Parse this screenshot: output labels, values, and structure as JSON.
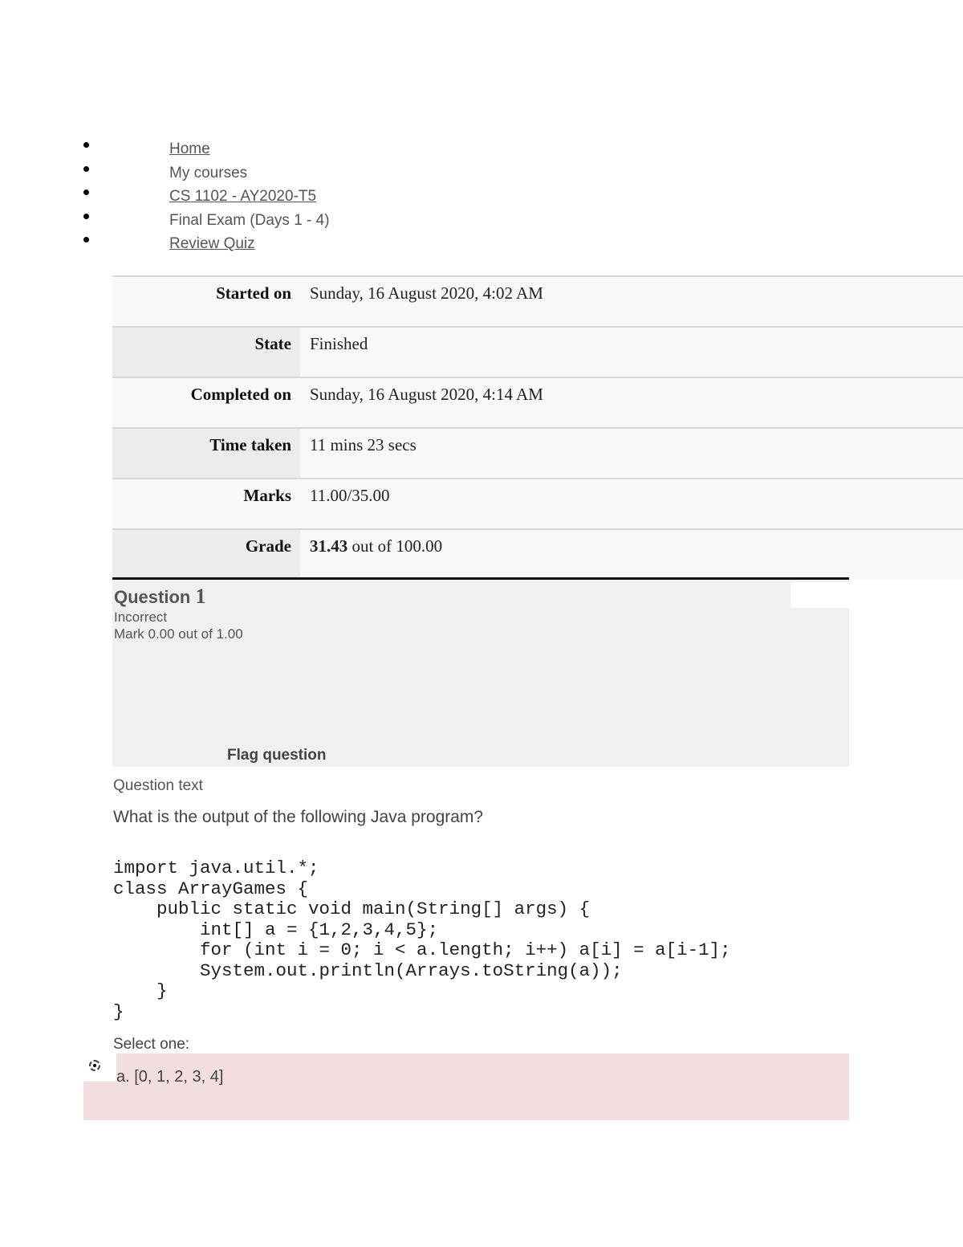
{
  "breadcrumb": [
    {
      "label": "Home",
      "link": true
    },
    {
      "label": "My courses",
      "link": false
    },
    {
      "label": "CS 1102 - AY2020-T5",
      "link": true
    },
    {
      "label": "Final Exam (Days 1 - 4)",
      "link": false
    },
    {
      "label": "Review Quiz",
      "link": true
    }
  ],
  "summary": {
    "started_on": {
      "label": "Started on",
      "value": "Sunday, 16 August 2020, 4:02 AM"
    },
    "state": {
      "label": "State",
      "value": "Finished"
    },
    "completed_on": {
      "label": "Completed on",
      "value": "Sunday, 16 August 2020, 4:14 AM"
    },
    "time_taken": {
      "label": "Time taken",
      "value": "11 mins 23 secs"
    },
    "marks": {
      "label": "Marks",
      "value": "11.00/35.00"
    },
    "grade": {
      "label": "Grade",
      "score": "31.43",
      "rest": " out of 100.00"
    }
  },
  "question": {
    "title": "Question ",
    "number": "1",
    "state": "Incorrect",
    "mark": "Mark 0.00 out of 1.00",
    "flag_label": "Flag question",
    "text_label": "Question text",
    "text": "What is the output of the following Java program?",
    "code": "import java.util.*;\nclass ArrayGames {\n    public static void main(String[] args) {\n        int[] a = {1,2,3,4,5};\n        for (int i = 0; i < a.length; i++) a[i] = a[i-1];\n        System.out.println(Arrays.toString(a));\n    }\n}",
    "select_label": "Select one:",
    "answer": "a. [0, 1, 2, 3, 4]",
    "answer_color": "#f2dede"
  }
}
